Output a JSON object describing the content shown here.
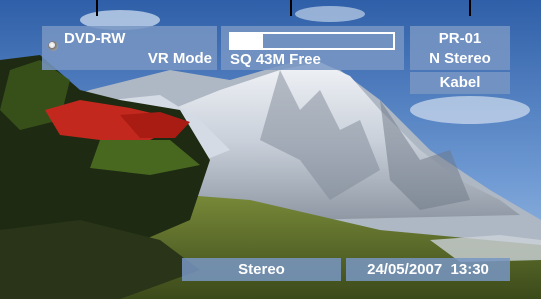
{
  "osd": {
    "disc": {
      "type": "DVD-RW",
      "mode": "VR Mode"
    },
    "space": {
      "text": "SQ  43M Free",
      "fill_fraction": 0.2
    },
    "program": {
      "number": "PR-01",
      "audio_mode": "N Stereo",
      "source": "Kabel"
    },
    "audio_output": "Stereo",
    "clock": {
      "datetime": "24/05/2007  13:30"
    }
  },
  "colors": {
    "osd_panel": "#7896c3",
    "osd_text": "#ffffff"
  },
  "icons": {
    "disc": "disc-icon"
  }
}
